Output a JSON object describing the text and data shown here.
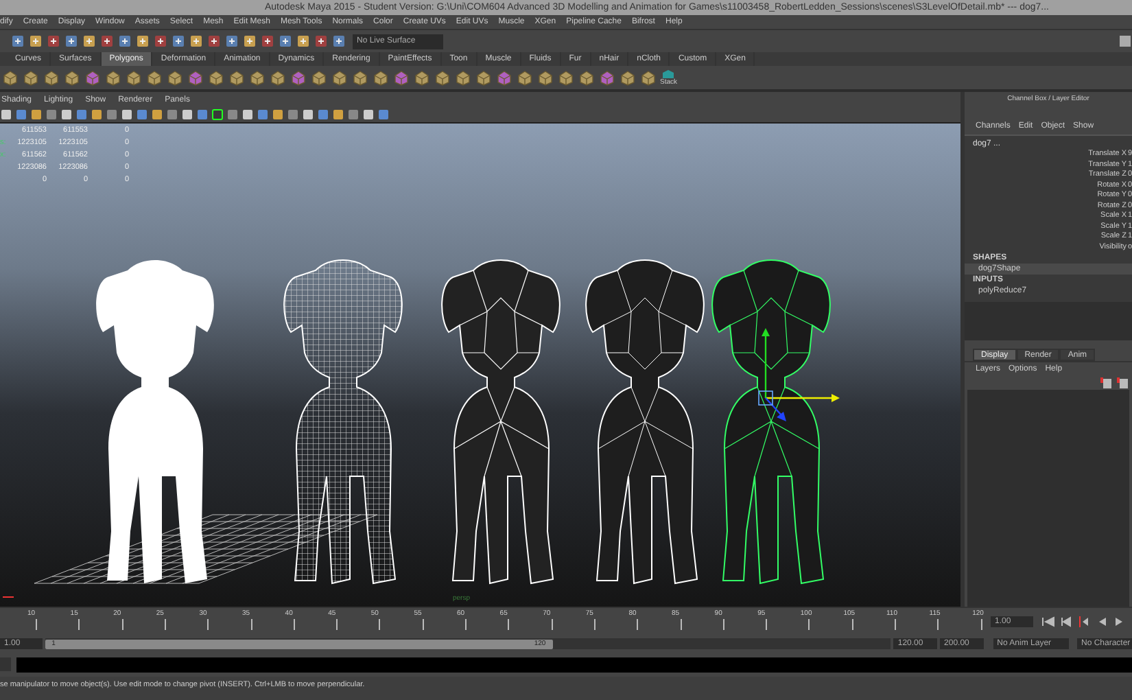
{
  "window": {
    "title": "Autodesk Maya 2015 - Student Version: G:\\Uni\\COM604 Advanced 3D Modelling and Animation for Games\\s11003458_RobertLedden_Sessions\\scenes\\S3LevelOfDetail.mb*   ---   dog7..."
  },
  "menu_bar": [
    "dify",
    "Create",
    "Display",
    "Window",
    "Assets",
    "Select",
    "Mesh",
    "Edit Mesh",
    "Mesh Tools",
    "Normals",
    "Color",
    "Create UVs",
    "Edit UVs",
    "Muscle",
    "XGen",
    "Pipeline Cache",
    "Bifrost",
    "Help"
  ],
  "status_line": {
    "live_surface": "No Live Surface"
  },
  "shelf_tabs": [
    {
      "label": "Curves",
      "selected": false
    },
    {
      "label": "Surfaces",
      "selected": false
    },
    {
      "label": "Polygons",
      "selected": true
    },
    {
      "label": "Deformation",
      "selected": false
    },
    {
      "label": "Animation",
      "selected": false
    },
    {
      "label": "Dynamics",
      "selected": false
    },
    {
      "label": "Rendering",
      "selected": false
    },
    {
      "label": "PaintEffects",
      "selected": false
    },
    {
      "label": "Toon",
      "selected": false
    },
    {
      "label": "Muscle",
      "selected": false
    },
    {
      "label": "Fluids",
      "selected": false
    },
    {
      "label": "Fur",
      "selected": false
    },
    {
      "label": "nHair",
      "selected": false
    },
    {
      "label": "nCloth",
      "selected": false
    },
    {
      "label": "Custom",
      "selected": false
    },
    {
      "label": "XGen",
      "selected": false
    }
  ],
  "shelf": {
    "stack_label": "Stack"
  },
  "viewport": {
    "menu": [
      "Shading",
      "Lighting",
      "Show",
      "Renderer",
      "Panels"
    ],
    "hud_rows": [
      {
        "label": "",
        "values": [
          "611553",
          "611553",
          "0"
        ]
      },
      {
        "label": "s:",
        "values": [
          "1223105",
          "1223105",
          "0"
        ]
      },
      {
        "label": "x:",
        "values": [
          "611562",
          "611562",
          "0"
        ]
      },
      {
        "label": "",
        "values": [
          "1223086",
          "1223086",
          "0"
        ]
      },
      {
        "label": "",
        "values": [
          "0",
          "0",
          "0"
        ]
      }
    ],
    "camera": "persp"
  },
  "channel_box": {
    "header": "Channel Box / Layer Editor",
    "menu": [
      "Channels",
      "Edit",
      "Object",
      "Show"
    ],
    "object": "dog7 ...",
    "attributes": [
      {
        "name": "Translate X",
        "value": "9"
      },
      {
        "name": "Translate Y",
        "value": "1"
      },
      {
        "name": "Translate Z",
        "value": "0"
      },
      {
        "name": "Rotate X",
        "value": "0"
      },
      {
        "name": "Rotate Y",
        "value": "0"
      },
      {
        "name": "Rotate Z",
        "value": "0"
      },
      {
        "name": "Scale X",
        "value": "1"
      },
      {
        "name": "Scale Y",
        "value": "1"
      },
      {
        "name": "Scale Z",
        "value": "1"
      },
      {
        "name": "Visibility",
        "value": "o"
      }
    ],
    "shapes_heading": "SHAPES",
    "shape": "dog7Shape",
    "inputs_heading": "INPUTS",
    "input": "polyReduce7"
  },
  "layer_editor": {
    "tabs": [
      {
        "label": "Display",
        "selected": true
      },
      {
        "label": "Render",
        "selected": false
      },
      {
        "label": "Anim",
        "selected": false
      }
    ],
    "menu": [
      "Layers",
      "Options",
      "Help"
    ]
  },
  "timeline": {
    "ticks": [
      "10",
      "15",
      "20",
      "25",
      "30",
      "35",
      "40",
      "45",
      "50",
      "55",
      "60",
      "65",
      "70",
      "75",
      "80",
      "85",
      "90",
      "95",
      "100",
      "105",
      "110",
      "115",
      "120"
    ],
    "current_frame": "1.00"
  },
  "range": {
    "level": 0.6,
    "start": "1.00",
    "slider_start": "1",
    "slider_end": "120",
    "end": "120.00",
    "anim_end": "200.00",
    "anim_layer": "No Anim Layer",
    "character": "No Character"
  },
  "help_line": "se manipulator to move object(s). Use edit mode to change pivot (INSERT).  Ctrl+LMB to move perpendicular."
}
